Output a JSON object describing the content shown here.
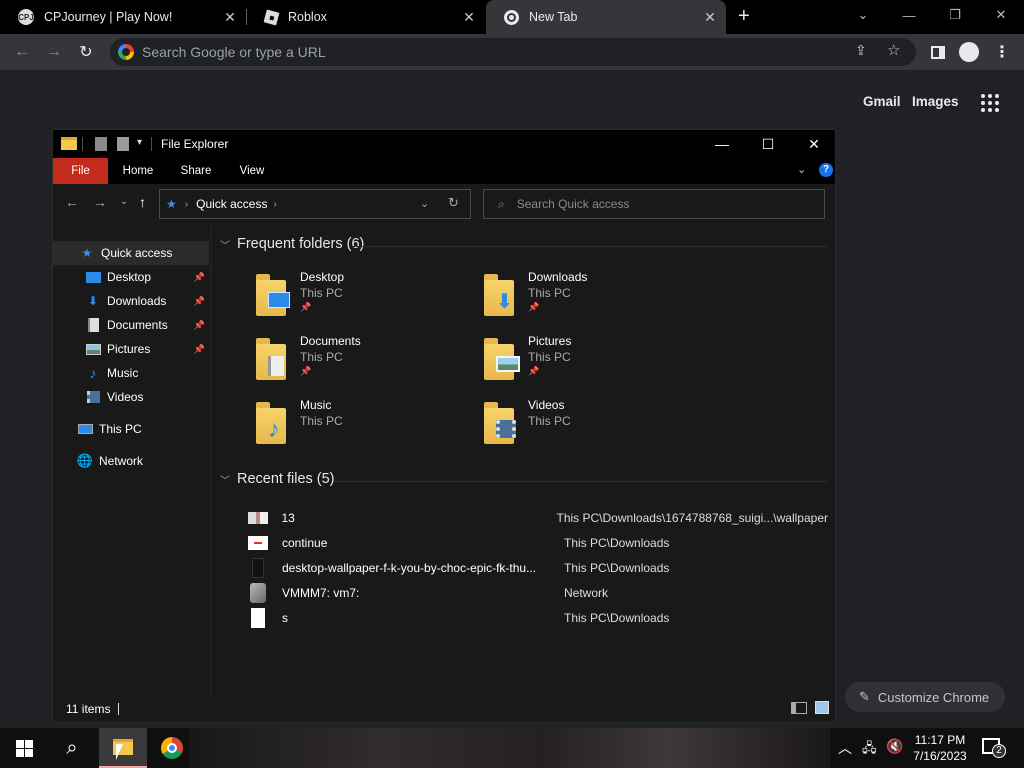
{
  "browser": {
    "tabs": [
      {
        "title": "CPJourney | Play Now!",
        "favicon": "cpj-icon",
        "active": false
      },
      {
        "title": "Roblox",
        "favicon": "roblox-icon",
        "active": false
      },
      {
        "title": "New Tab",
        "favicon": "chrome-icon",
        "active": true
      }
    ],
    "omnibox_placeholder": "Search Google or type a URL"
  },
  "ntp": {
    "gmail": "Gmail",
    "images": "Images",
    "customize": "Customize Chrome"
  },
  "explorer": {
    "title": "File Explorer",
    "ribbon": {
      "file": "File",
      "home": "Home",
      "share": "Share",
      "view": "View"
    },
    "address": "Quick access",
    "search_placeholder": "Search Quick access",
    "nav": {
      "quick_access": "Quick access",
      "desktop": "Desktop",
      "downloads": "Downloads",
      "documents": "Documents",
      "pictures": "Pictures",
      "music": "Music",
      "videos": "Videos",
      "this_pc": "This PC",
      "network": "Network"
    },
    "frequent_header": "Frequent folders (6)",
    "folders": [
      {
        "name": "Desktop",
        "location": "This PC",
        "pinned": true
      },
      {
        "name": "Downloads",
        "location": "This PC",
        "pinned": true
      },
      {
        "name": "Documents",
        "location": "This PC",
        "pinned": true
      },
      {
        "name": "Pictures",
        "location": "This PC",
        "pinned": true
      },
      {
        "name": "Music",
        "location": "This PC",
        "pinned": false
      },
      {
        "name": "Videos",
        "location": "This PC",
        "pinned": false
      }
    ],
    "recent_header": "Recent files (5)",
    "recent": [
      {
        "name": "13",
        "location": "This PC\\Downloads\\1674788768_suigi...\\wallpaper"
      },
      {
        "name": "continue",
        "location": "This PC\\Downloads"
      },
      {
        "name": "desktop-wallpaper-f-k-you-by-choc-epic-fk-thu...",
        "location": "This PC\\Downloads"
      },
      {
        "name": "VMMM7: vm7:",
        "location": "Network"
      },
      {
        "name": "s",
        "location": "This PC\\Downloads"
      }
    ],
    "status": "11 items"
  },
  "taskbar": {
    "time": "11:17 PM",
    "date": "7/16/2023",
    "notifications": "2"
  }
}
